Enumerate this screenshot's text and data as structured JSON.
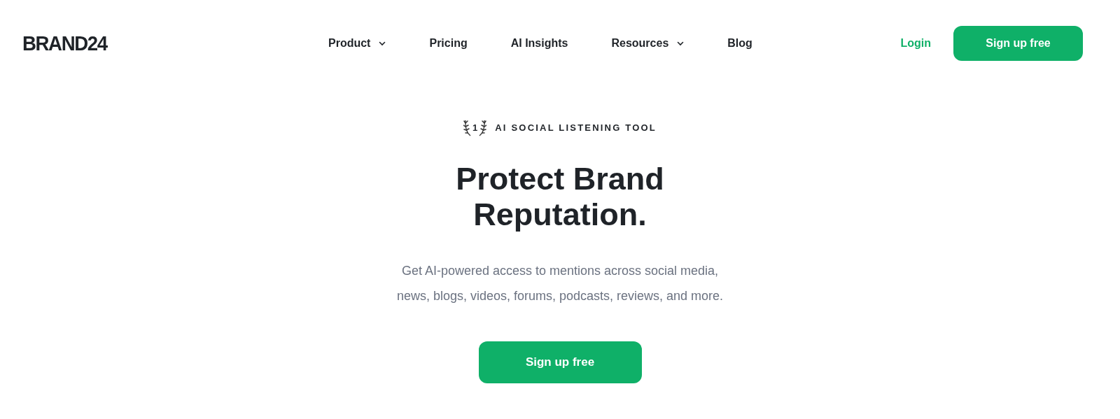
{
  "header": {
    "logo": "BRAND24",
    "nav": [
      {
        "label": "Product",
        "dropdown": true
      },
      {
        "label": "Pricing",
        "dropdown": false
      },
      {
        "label": "AI Insights",
        "dropdown": false
      },
      {
        "label": "Resources",
        "dropdown": true
      },
      {
        "label": "Blog",
        "dropdown": false
      }
    ],
    "login": "Login",
    "signup": "Sign up free"
  },
  "hero": {
    "badge": {
      "rank": "1",
      "text": "AI SOCIAL LISTENING TOOL"
    },
    "title_lines": [
      "Protect Brand",
      "Reputation."
    ],
    "description_lines": [
      "Get AI-powered access to mentions across social media,",
      "news, blogs, videos, forums, podcasts, reviews, and more."
    ],
    "cta": "Sign up free"
  }
}
